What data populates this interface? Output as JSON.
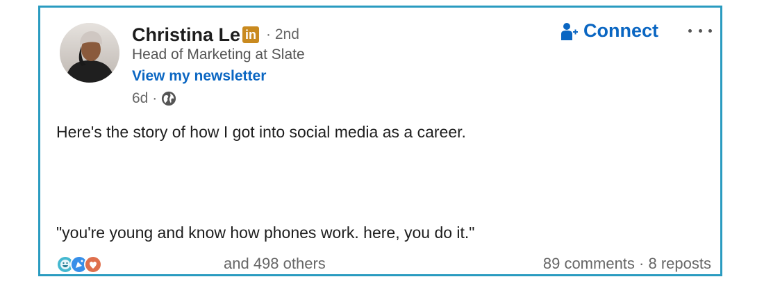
{
  "author": {
    "name": "Christina Le",
    "badge": "in",
    "degree": "· 2nd",
    "headline": "Head of Marketing at Slate",
    "newsletter_link": "View my newsletter"
  },
  "post_meta": {
    "time": "6d ·",
    "visibility_icon": "globe-icon"
  },
  "actions": {
    "connect_label": "Connect",
    "connect_icon": "add-person-icon",
    "more_icon": "ellipsis-icon"
  },
  "post": {
    "line1": "Here's the story of how I got into social media as a career.",
    "line2": "\"you're young and know how phones work. here, you do it.\""
  },
  "engagement": {
    "reaction_icons": [
      "funny-icon",
      "celebrate-icon",
      "love-icon"
    ],
    "others": "and 498 others",
    "comments": "89 comments",
    "separator": "·",
    "reposts": "8 reposts"
  },
  "colors": {
    "border": "#2a9bc0",
    "link_blue": "#0a66c2",
    "badge_gold": "#c98a1f"
  }
}
